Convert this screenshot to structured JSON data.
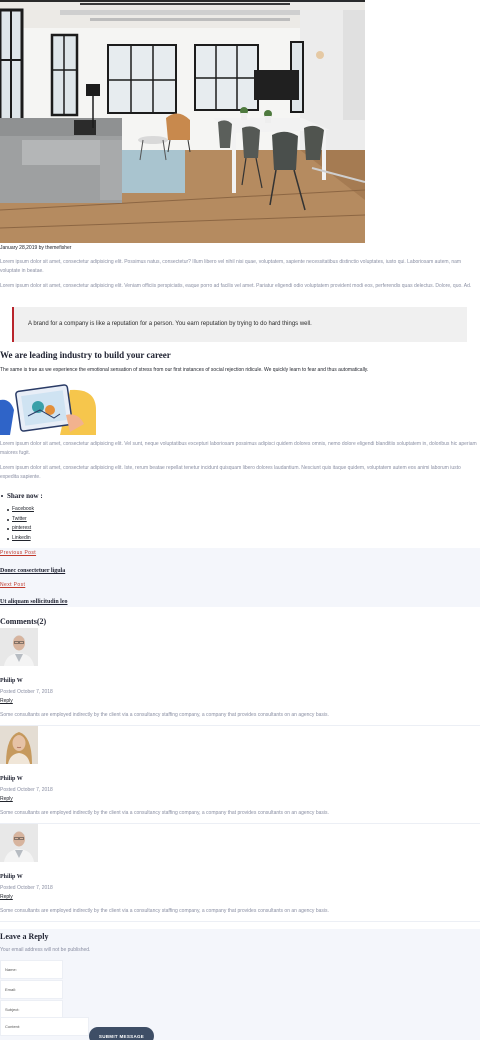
{
  "post": {
    "meta": "January 28,2019 by themefisher",
    "para1": "Lorem ipsum dolor sit amet, consectetur adipisicing elit. Possimus natus, consectetur? Illum libero vel nihil nisi quae, voluptatem, sapiente necessitatibus distinctio voluptates, iusto qui. Laboriosam autem, nam voluptate in beatae.",
    "para2": "Lorem ipsum dolor sit amet, consectetur adipisicing elit. Veniam officiis perspiciatis, eaque porro ad facilis vel amet. Pariatur eligendi odio voluptatem provident modi eos, perferendis quas delectus. Dolore, quo. Ad.",
    "quote": "A brand for a company is like a reputation for a person. You earn reputation by trying to do hard things well.",
    "heading": "We are leading industry to build your career",
    "lead": "The same is true as we experience the emotional sensation of stress from our first instances of social rejection ridicule. We quickly learn to fear and thus automatically.",
    "para3": "Lorem ipsum dolor sit amet, consectetur adipisicing elit. Vel sunt, neque voluptatibus excepturi laboriosam possimus adipisci quidem dolores omnis, nemo dolore eligendi blanditiis soluptatem in, doloribus hic aperiam maiores fugit.",
    "para4": "Lorem ipsum dolor sit amet, consectetur adipisicing elit. Iste, rerum beatae repellat tenetur incidunt quisquam libero dolores laudantium. Nesciunt quis itaque quidem, voluptatem autem eos animi laborum iusto expedita sapiente."
  },
  "share": {
    "title": "Share now :",
    "items": [
      "Facebook",
      "Twitter",
      "pinterest",
      "Linkedin"
    ]
  },
  "postnav": {
    "prev_label": "Previous Post",
    "prev_title": "Donec consectetuer ligula",
    "next_label": "Next Post",
    "next_title": "Ut aliquam sollicitudin leo"
  },
  "comments": {
    "title": "Comments(2)",
    "items": [
      {
        "name": "Philip W",
        "date": "Posted October 7, 2018",
        "reply": "Reply",
        "text": "Some consultants are employed indirectly by the client via a consultancy staffing company, a company that provides consultants on an agency basis."
      },
      {
        "name": "Philip W",
        "date": "Posted October 7, 2018",
        "reply": "Reply",
        "text": "Some consultants are employed indirectly by the client via a consultancy staffing company, a company that provides consultants on an agency basis."
      },
      {
        "name": "Philip W",
        "date": "Posted October 7, 2018",
        "reply": "Reply",
        "text": "Some consultants are employed indirectly by the client via a consultancy staffing company, a company that provides consultants on an agency basis."
      }
    ]
  },
  "reply_form": {
    "title": "Leave a Reply",
    "note": "Your email address will not be published.",
    "name_placeholder": "Name:",
    "email_placeholder": "Email:",
    "subject_placeholder": "Subject:",
    "content_placeholder": "Content:",
    "submit_label": "SUBMIT MESSAGE"
  },
  "colors": {
    "accent": "#c0392b",
    "heading": "#1e2130",
    "body_text": "#8a8fa3",
    "submit_bg": "#3e4e66"
  }
}
